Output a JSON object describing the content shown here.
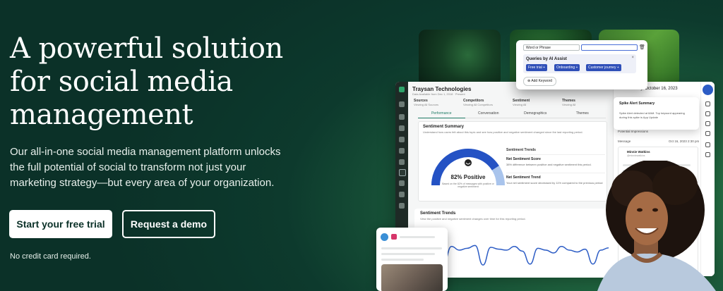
{
  "hero": {
    "headline": "A powerful solution for social media management",
    "subtext": "Our all-in-one social media management platform unlocks the full potential of social to transform not just your marketing strategy—but every area of your organization.",
    "primary_cta": "Start your free trial",
    "secondary_cta": "Request a demo",
    "note": "No credit card required."
  },
  "keyword_popup": {
    "select_value": "Word or Phrase",
    "group_title": "Queries by AI Assist",
    "chips": [
      "Free trial",
      "Onboarding",
      "Customer journey"
    ],
    "add_label": "Add Keyword"
  },
  "dashboard": {
    "brand": "Traysan Technologies",
    "brand_sub": "Data Available from Dec 1, 2018 · Present",
    "filters": [
      {
        "label": "Sources",
        "value": "Viewing All Sources"
      },
      {
        "label": "Competitors",
        "value": "Viewing All Competitors"
      },
      {
        "label": "Sentiment",
        "value": "Viewing All"
      },
      {
        "label": "Themes",
        "value": "Viewing All"
      }
    ],
    "tabs": [
      "Performance",
      "Conversation",
      "Demographics",
      "Themes"
    ],
    "summary_title": "Sentiment Summary",
    "summary_desc": "Understand how users felt about this topic and see how positive and negative sentiment changed since the last reporting period.",
    "gauge_value": "82% Positive",
    "gauge_fraction": 0.82,
    "gauge_note": "Based on the 82% of messages with positive or negative sentiment",
    "trends_heading": "Sentiment Trends",
    "net_score_title": "Net Sentiment Score",
    "net_score_text": "38% difference between positive and negative sentiment this period.",
    "net_trend_title": "Net Sentiment Trend",
    "net_trend_text": "Your net sentiment score decreased by 11% compared to the previous period",
    "date": "Monday, October 16, 2023",
    "spike_label": "Spike Alert Summary",
    "potential_impressions": "Potential Impressions",
    "message_label": "Message",
    "message_date": "Oct 16, 2023 2:30 pm",
    "author": "Minnie Watkins",
    "author_handle": "@minniewatkins"
  },
  "spike_card": {
    "text": "Spike Alert detected at 8AM. Top keyword appearing during this spike is App Update"
  },
  "trends_card": {
    "title": "Sentiment Trends",
    "desc": "View the positive and negative sentiment changes over time for this reporting period."
  },
  "chart_data": {
    "type": "line",
    "values": [
      52,
      48,
      55,
      22,
      58,
      50,
      54,
      60,
      18,
      56,
      52,
      50,
      58,
      48,
      20,
      54,
      50,
      44,
      58,
      50,
      46,
      52,
      20,
      50,
      55
    ],
    "ylim": [
      0,
      100
    ],
    "title": "",
    "xlabel": "",
    "ylabel": ""
  },
  "colors": {
    "brand_dark": "#0b3128",
    "accent_blue": "#2f4fb8",
    "chart_line": "#2c5cc5"
  }
}
